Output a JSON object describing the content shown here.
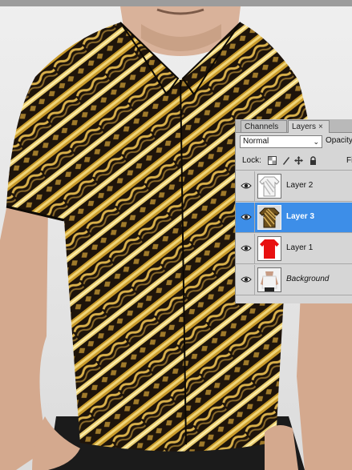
{
  "panel": {
    "tabs": [
      {
        "label": "Channels"
      },
      {
        "label": "Layers",
        "close": "×"
      }
    ],
    "blend_mode": "Normal",
    "opacity_label": "Opacity",
    "lock_label": "Lock:",
    "fill_label": "Fi",
    "layers": [
      {
        "name": "Layer 2",
        "visible": true,
        "selected": false,
        "thumb": "white-batik-shirt"
      },
      {
        "name": "Layer 3",
        "visible": true,
        "selected": true,
        "thumb": "brown-batik-shirt"
      },
      {
        "name": "Layer 1",
        "visible": true,
        "selected": false,
        "thumb": "red-shirt"
      },
      {
        "name": "Background",
        "visible": true,
        "selected": false,
        "thumb": "model-photo"
      }
    ],
    "colors": {
      "selection": "#3d8ee8",
      "panel_bg": "#d6d6d6"
    }
  },
  "canvas": {
    "subject": "man wearing brown and gold batik parang shirt",
    "colors": {
      "batik_gold": "#c89a2a",
      "batik_dark": "#1e140a",
      "skin": "#d9b29a"
    }
  }
}
